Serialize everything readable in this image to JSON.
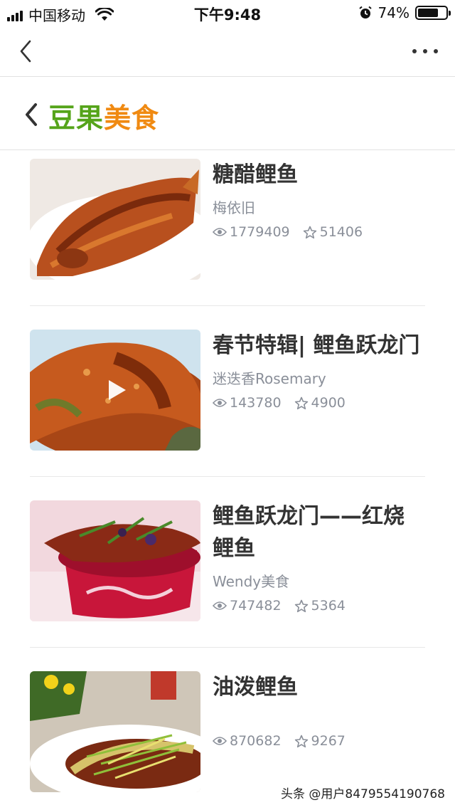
{
  "status_bar": {
    "carrier": "中国移动",
    "time": "下午9:48",
    "battery_percent": "74%",
    "battery_level": 0.74
  },
  "nav": {
    "back_icon": "chevron-left-icon",
    "more_icon": "more-horizontal-icon"
  },
  "brand": {
    "title_part1": "豆果",
    "title_part2": "美食",
    "color_part1": "#55a41a",
    "color_part2": "#f08a12"
  },
  "recipes": [
    {
      "title": "糖醋鲤鱼",
      "author": "梅依旧",
      "views": "1779409",
      "favorites": "51406",
      "is_video": false
    },
    {
      "title": "春节特辑| 鲤鱼跃龙门",
      "author": "迷迭香Rosemary",
      "views": "143780",
      "favorites": "4900",
      "is_video": true
    },
    {
      "title": "鲤鱼跃龙门——红烧鲤鱼",
      "author": "Wendy美食",
      "views": "747482",
      "favorites": "5364",
      "is_video": false
    },
    {
      "title": "油泼鲤鱼",
      "author": "",
      "views": "870682",
      "favorites": "9267",
      "is_video": false
    }
  ],
  "watermark": "头条 @用户8479554190768"
}
